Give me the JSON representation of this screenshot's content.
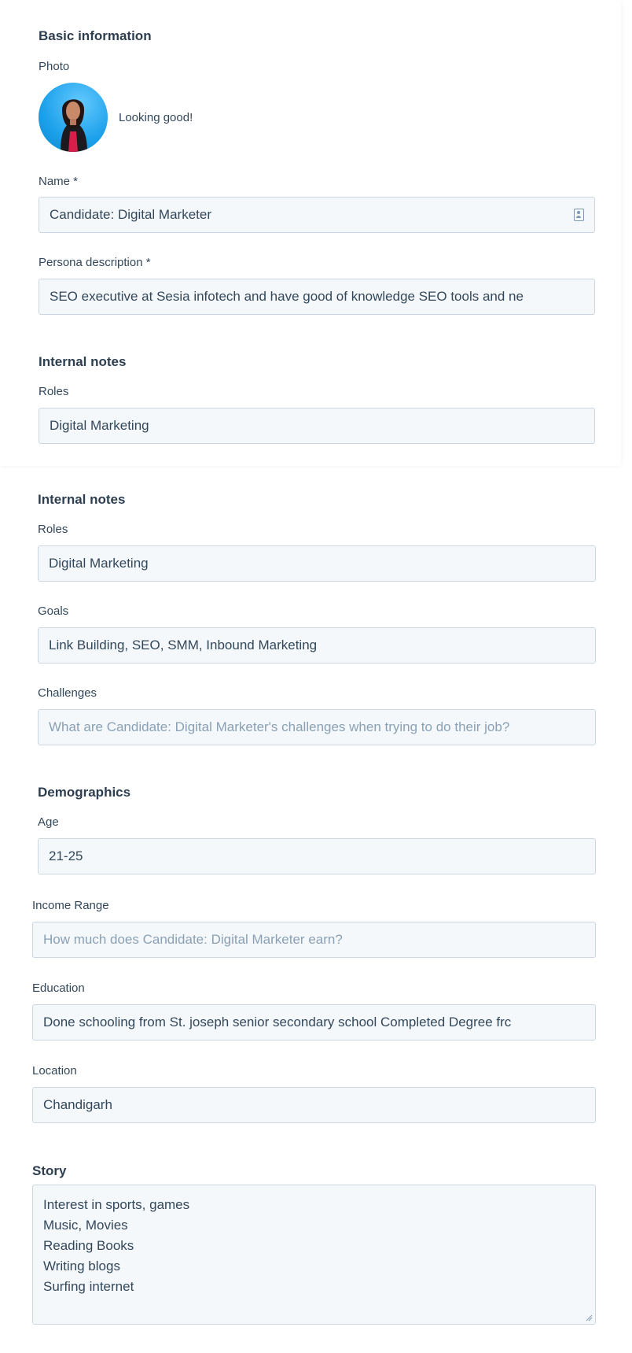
{
  "basic_info": {
    "title": "Basic information",
    "photo_label": "Photo",
    "photo_caption": "Looking good!",
    "name_label": "Name *",
    "name_value": "Candidate: Digital Marketer",
    "persona_label": "Persona description *",
    "persona_value": "SEO executive at Sesia infotech  and have good of knowledge SEO tools and ne"
  },
  "internal_notes_1": {
    "title": "Internal notes",
    "roles_label": "Roles",
    "roles_value": "Digital Marketing"
  },
  "internal_notes_2": {
    "title": "Internal notes",
    "roles_label": "Roles",
    "roles_value": "Digital Marketing",
    "goals_label": "Goals",
    "goals_value": "Link Building, SEO, SMM, Inbound Marketing",
    "challenges_label": "Challenges",
    "challenges_placeholder": "What are Candidate: Digital Marketer's challenges when trying to do their job?"
  },
  "demographics": {
    "title": "Demographics",
    "age_label": "Age",
    "age_value": "21-25",
    "income_label": "Income Range",
    "income_placeholder": "How much does Candidate: Digital Marketer earn?",
    "education_label": "Education",
    "education_value": "Done schooling from St. joseph senior secondary school  Completed Degree frc",
    "location_label": "Location",
    "location_value": "Chandigarh"
  },
  "story": {
    "title": "Story",
    "lines": [
      "Interest in sports, games",
      "Music, Movies",
      "Reading Books",
      "Writing blogs",
      "Surfing internet"
    ]
  },
  "colors": {
    "field_bg": "#f5f8fa",
    "field_border": "#cbd6e2",
    "text": "#33475b",
    "placeholder": "#8aa0b5",
    "heading": "#2d3e50"
  }
}
